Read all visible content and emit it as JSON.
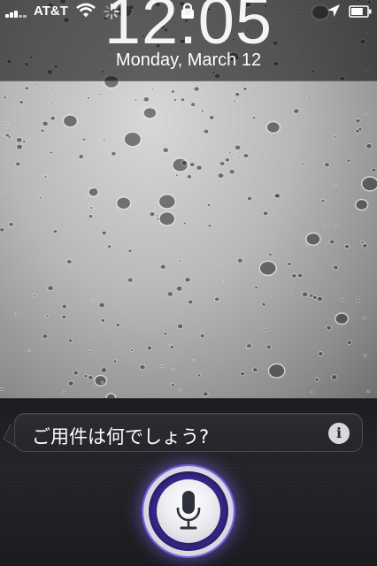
{
  "status_bar": {
    "carrier": "AT&T",
    "icons": [
      "signal-icon",
      "wifi-icon",
      "activity-spinner-icon",
      "lock-icon",
      "location-icon",
      "battery-icon"
    ],
    "battery_level": 0.75
  },
  "lock_screen": {
    "time": "12:05",
    "date": "Monday, March 12"
  },
  "siri": {
    "prompt": "ご用件は何でしょう?",
    "info_icon": "i",
    "mic_icon": "microphone-icon",
    "accent_color": "#5e3fc9"
  }
}
